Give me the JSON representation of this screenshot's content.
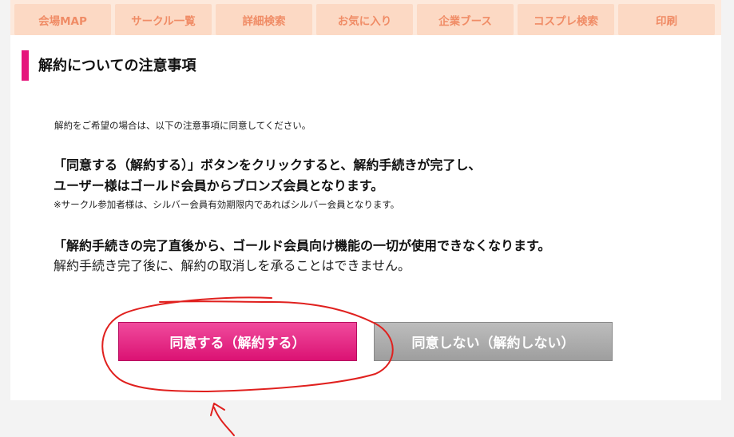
{
  "nav": {
    "tabs": [
      {
        "label": "会場MAP"
      },
      {
        "label": "サークル一覧"
      },
      {
        "label": "詳細検索"
      },
      {
        "label": "お気に入り"
      },
      {
        "label": "企業ブース"
      },
      {
        "label": "コスプレ検索"
      },
      {
        "label": "印刷"
      }
    ]
  },
  "page": {
    "title": "解約についての注意事項",
    "intro": "解約をご希望の場合は、以下の注意事項に同意してください。",
    "bold_line_1": "「同意する（解約する）」ボタンをクリックすると、解約手続きが完了し、",
    "bold_line_2": "ユーザー様はゴールド会員からブロンズ会員となります。",
    "note": "※サークル参加者様は、シルバー会員有効期限内であればシルバー会員となります。",
    "bold_line_3": "「解約手続きの完了直後から、ゴールド会員向け機能の一切が使用できなくなります。",
    "normal_line": "解約手続き完了後に、解約の取消しを承ることはできません。"
  },
  "buttons": {
    "agree_label": "同意する（解約する）",
    "decline_label": "同意しない（解約しない）"
  },
  "colors": {
    "accent": "#e5157c",
    "tab_bg": "#fcd9c4",
    "tab_text": "#f08c66",
    "annotation": "#e0201e"
  }
}
